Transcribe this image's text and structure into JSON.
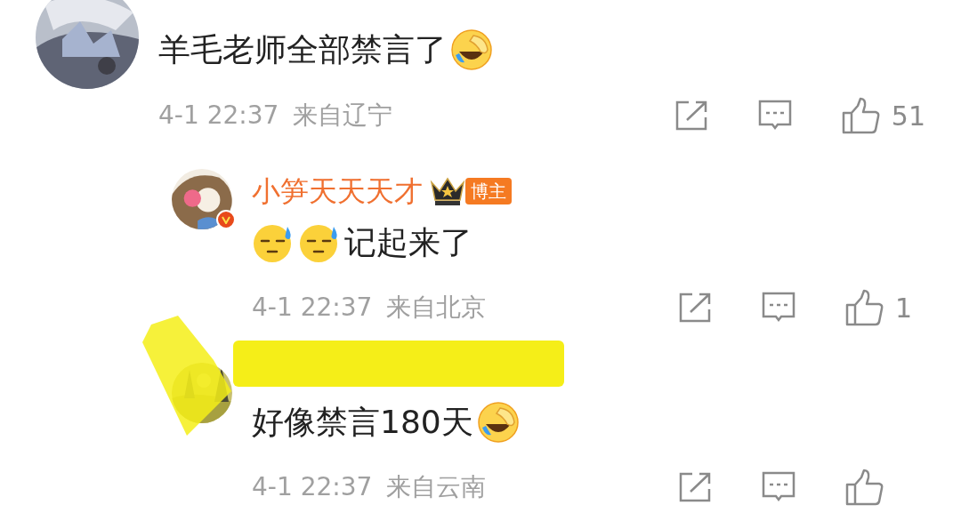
{
  "comments": [
    {
      "verified": false,
      "segments": [
        {
          "kind": "text",
          "text": "羊毛老师全部禁言了"
        },
        {
          "kind": "laughcry"
        }
      ],
      "time": "4-1 22:37",
      "location": "来自辽宁",
      "likes": "51",
      "reply": false
    },
    {
      "verified": true,
      "name": "小笋天天天才",
      "badge": "博主",
      "segments": [
        {
          "kind": "sweat"
        },
        {
          "kind": "sweat"
        },
        {
          "kind": "text",
          "text": "记起来了"
        }
      ],
      "time": "4-1 22:37",
      "location": "来自北京",
      "likes": "1",
      "reply": true
    },
    {
      "verified": false,
      "segments": [
        {
          "kind": "text",
          "text": "好像禁言180天"
        },
        {
          "kind": "laughcry"
        }
      ],
      "time": "4-1 22:37",
      "location": "来自云南",
      "reply": true
    }
  ]
}
